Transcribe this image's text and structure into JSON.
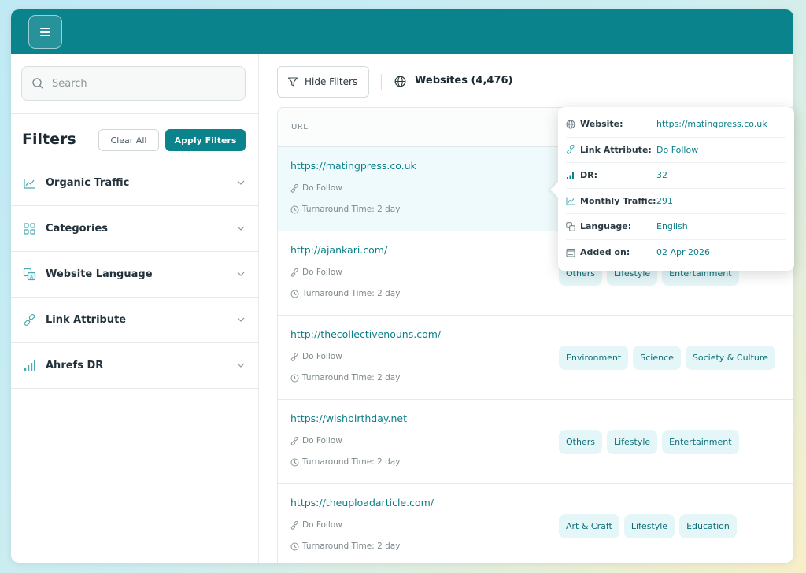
{
  "theme": {
    "accent": "#0b838c",
    "tag_bg": "#e4f6f8",
    "link": "#0b7f88"
  },
  "topbar": {
    "menu_icon": "hamburger-icon"
  },
  "sidebar": {
    "search_placeholder": "Search",
    "title": "Filters",
    "clear_all_label": "Clear All",
    "apply_label": "Apply Filters",
    "items": [
      {
        "label": "Organic Traffic",
        "icon": "line-chart-icon"
      },
      {
        "label": "Categories",
        "icon": "grid-icon"
      },
      {
        "label": "Website Language",
        "icon": "translate-icon"
      },
      {
        "label": "Link Attribute",
        "icon": "link-icon"
      },
      {
        "label": "Ahrefs DR",
        "icon": "bar-chart-icon"
      }
    ]
  },
  "main": {
    "hide_filters_label": "Hide Filters",
    "websites_label": "Websites (4,476)",
    "column_url": "URL",
    "rows": [
      {
        "url": "https://matingpress.co.uk",
        "link": "Do Follow",
        "time": "Turnaround Time: 2 day",
        "tags": []
      },
      {
        "url": "http://ajankari.com/",
        "link": "Do Follow",
        "time": "Turnaround Time: 2 day",
        "tags": [
          "Others",
          "Lifestyle",
          "Entertainment"
        ]
      },
      {
        "url": "http://thecollectivenouns.com/",
        "link": "Do Follow",
        "time": "Turnaround Time: 2 day",
        "tags": [
          "Environment",
          "Science",
          "Society & Culture"
        ]
      },
      {
        "url": "https://wishbirthday.net",
        "link": "Do Follow",
        "time": "Turnaround Time: 2 day",
        "tags": [
          "Others",
          "Lifestyle",
          "Entertainment"
        ]
      },
      {
        "url": "https://theuploadarticle.com/",
        "link": "Do Follow",
        "time": "Turnaround Time: 2 day",
        "tags": [
          "Art & Craft",
          "Lifestyle",
          "Education"
        ]
      }
    ]
  },
  "tooltip": {
    "rows": [
      {
        "label": "Website:",
        "value": "https://matingpress.co.uk",
        "icon": "globe-icon"
      },
      {
        "label": "Link Attribute:",
        "value": "Do Follow",
        "icon": "link-icon"
      },
      {
        "label": "DR:",
        "value": "32",
        "icon": "bar-chart-icon"
      },
      {
        "label": "Monthly Traffic:",
        "value": "291",
        "icon": "line-chart-icon"
      },
      {
        "label": "Language:",
        "value": "English",
        "icon": "translate-icon"
      },
      {
        "label": "Added on:",
        "value": "02 Apr 2026",
        "icon": "calendar-icon"
      }
    ]
  }
}
